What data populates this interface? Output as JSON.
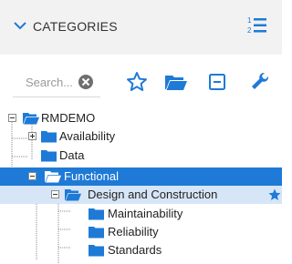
{
  "header": {
    "title": "CATEGORIES"
  },
  "toolbar": {
    "search_placeholder": "Search...",
    "icons": [
      "star-icon",
      "folder-open-icon",
      "collapse-icon",
      "wrench-icon"
    ]
  },
  "colors": {
    "accent": "#1e7ad6",
    "folder": "#1e7ad6",
    "selected_row": "#1e7ad6",
    "highlight_row": "#d6e6f7"
  },
  "tree": {
    "root": "RMDEMO",
    "items": [
      {
        "label": "Availability"
      },
      {
        "label": "Data"
      },
      {
        "label": "Functional"
      },
      {
        "label": "Design and Construction"
      },
      {
        "label": "Maintainability"
      },
      {
        "label": "Reliability"
      },
      {
        "label": "Standards"
      }
    ]
  }
}
